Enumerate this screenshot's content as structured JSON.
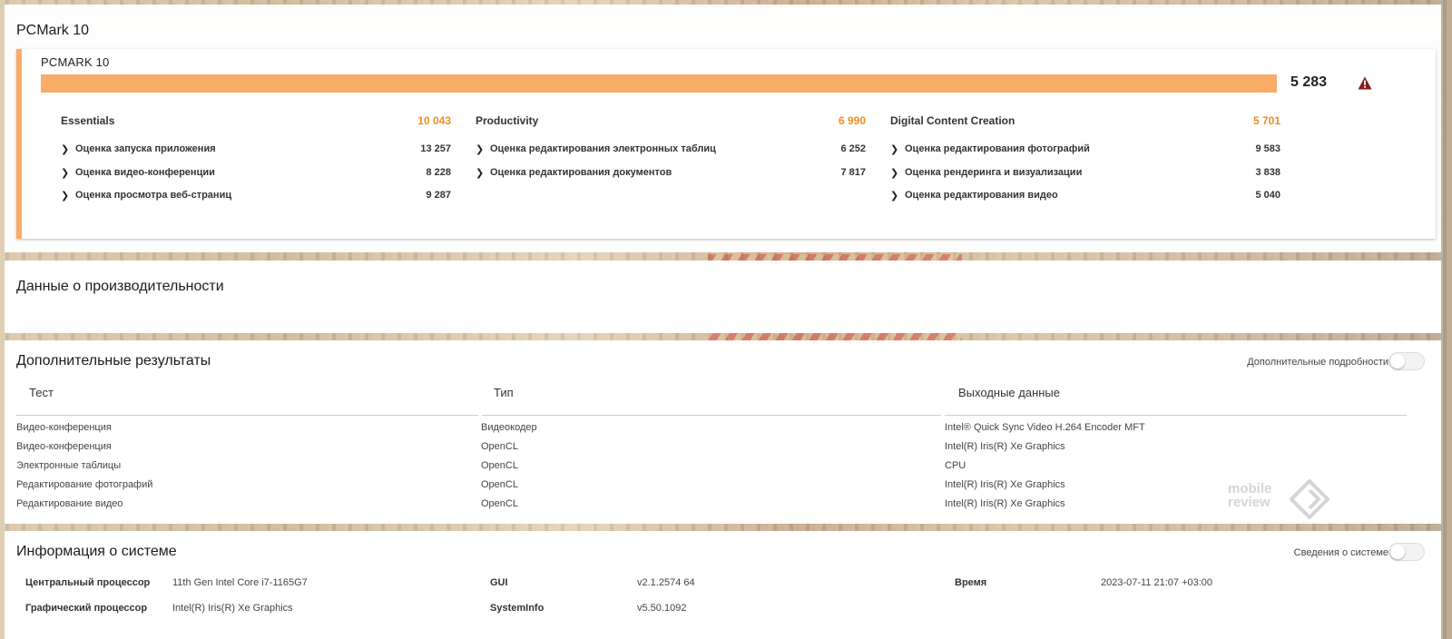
{
  "pcmark_section": {
    "title": "PCMark 10",
    "card_title": "PCMARK 10",
    "overall_score": "5 283",
    "warning_icon": "warning-triangle-icon",
    "bar_fill_fraction": 1.0,
    "groups": [
      {
        "name": "Essentials",
        "score": "10 043",
        "items": [
          {
            "label": "Оценка запуска приложения",
            "value": "13 257"
          },
          {
            "label": "Оценка видео-конференции",
            "value": "8 228"
          },
          {
            "label": "Оценка просмотра веб-страниц",
            "value": "9 287"
          }
        ]
      },
      {
        "name": "Productivity",
        "score": "6 990",
        "items": [
          {
            "label": "Оценка редактирования электронных таблиц",
            "value": "6 252"
          },
          {
            "label": "Оценка редактирования документов",
            "value": "7 817"
          }
        ]
      },
      {
        "name": "Digital Content Creation",
        "score": "5 701",
        "items": [
          {
            "label": "Оценка редактирования фотографий",
            "value": "9 583"
          },
          {
            "label": "Оценка рендеринга и визуализации",
            "value": "3 838"
          },
          {
            "label": "Оценка редактирования видео",
            "value": "5 040"
          }
        ]
      }
    ]
  },
  "performance_section": {
    "title": "Данные о производительности"
  },
  "additional_section": {
    "title": "Дополнительные результаты",
    "toggle_label": "Дополнительные подробности",
    "columns": [
      "Тест",
      "Тип",
      "Выходные данные"
    ],
    "rows": [
      [
        "Видео-конференция",
        "Видеокодер",
        "Intel® Quick Sync Video H.264 Encoder MFT"
      ],
      [
        "Видео-конференция",
        "OpenCL",
        "Intel(R) Iris(R) Xe Graphics"
      ],
      [
        "Электронные таблицы",
        "OpenCL",
        "CPU"
      ],
      [
        "Редактирование фотографий",
        "OpenCL",
        "Intel(R) Iris(R) Xe Graphics"
      ],
      [
        "Редактирование видео",
        "OpenCL",
        "Intel(R) Iris(R) Xe Graphics"
      ]
    ],
    "watermark": {
      "line1": "mobile",
      "line2": "review"
    }
  },
  "system_section": {
    "title": "Информация о системе",
    "toggle_label": "Сведения о системе",
    "fields": {
      "cpu_label": "Центральный процессор",
      "cpu_value": "11th Gen Intel Core i7-1165G7",
      "gpu_label": "Графический процессор",
      "gpu_value": "Intel(R) Iris(R) Xe Graphics",
      "gui_label": "GUI",
      "gui_value": "v2.1.2574 64",
      "sysinfo_label": "SystemInfo",
      "sysinfo_value": "v5.50.1092",
      "time_label": "Время",
      "time_value": "2023-07-11 21:07 +03:00"
    }
  },
  "colors": {
    "accent_orange": "#f9ab68",
    "score_orange": "#f08c1e",
    "warning_red": "#8b1a1a"
  }
}
